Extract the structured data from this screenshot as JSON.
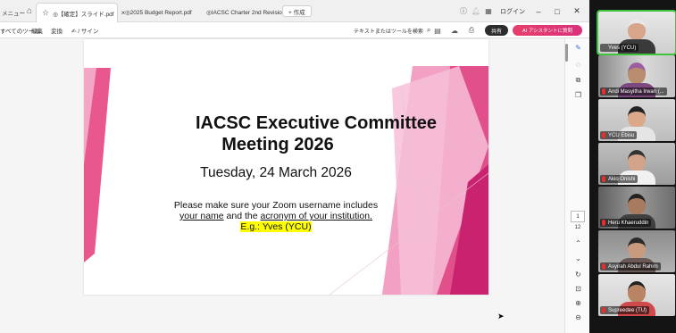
{
  "browser": {
    "tabs": [
      {
        "label": "メニュー",
        "active": false,
        "closable": false
      },
      {
        "label": "◎【確定】スライド.pdf",
        "active": true,
        "closable": true
      },
      {
        "label": "◎2025 Budget Report.pdf",
        "active": false,
        "closable": false
      },
      {
        "label": "◎IACSC Charter 2nd Revisio...",
        "active": false,
        "closable": false
      }
    ],
    "new_tab_label": "+ 作成",
    "login_label": "ログイン",
    "window_buttons": [
      "–",
      "□",
      "✕"
    ]
  },
  "toolbar": {
    "items": [
      "すべてのツール",
      "編集",
      "変換",
      "✍ / サイン"
    ],
    "search_label": "テキストまたはツールを検索",
    "share_label": "共有",
    "ai_label": "AI アシスタントに質問"
  },
  "slide": {
    "title_line1": "IACSC Executive Committee",
    "title_line2": "Meeting 2026",
    "date": "Tuesday, 24 March 2026",
    "note_line1": "Please make sure your Zoom username includes",
    "note_your_name": "your name",
    "note_and_the": " and the ",
    "note_acronym": "acronym of your institution.",
    "note_example": "E.g.: Yves (YCU)"
  },
  "page_nav": {
    "current": "1",
    "total": "12"
  },
  "participants": [
    {
      "name": "Yves (YCU)",
      "speaking": true,
      "muted": false
    },
    {
      "name": "Andi Masyitha Irwan (...",
      "speaking": false,
      "muted": true
    },
    {
      "name": "YCU Ebisu",
      "speaking": false,
      "muted": true
    },
    {
      "name": "Akio Onishi",
      "speaking": false,
      "muted": true
    },
    {
      "name": "Heru  Khaeruddin",
      "speaking": false,
      "muted": true
    },
    {
      "name": "Asyirah Abdul Rahim",
      "speaking": false,
      "muted": true
    },
    {
      "name": "Supreedee (TU)",
      "speaking": false,
      "muted": true
    }
  ],
  "colors": {
    "accent_pink": "#d9327c",
    "speaking_outline": "#3ec43e",
    "highlight": "#ffff00"
  }
}
